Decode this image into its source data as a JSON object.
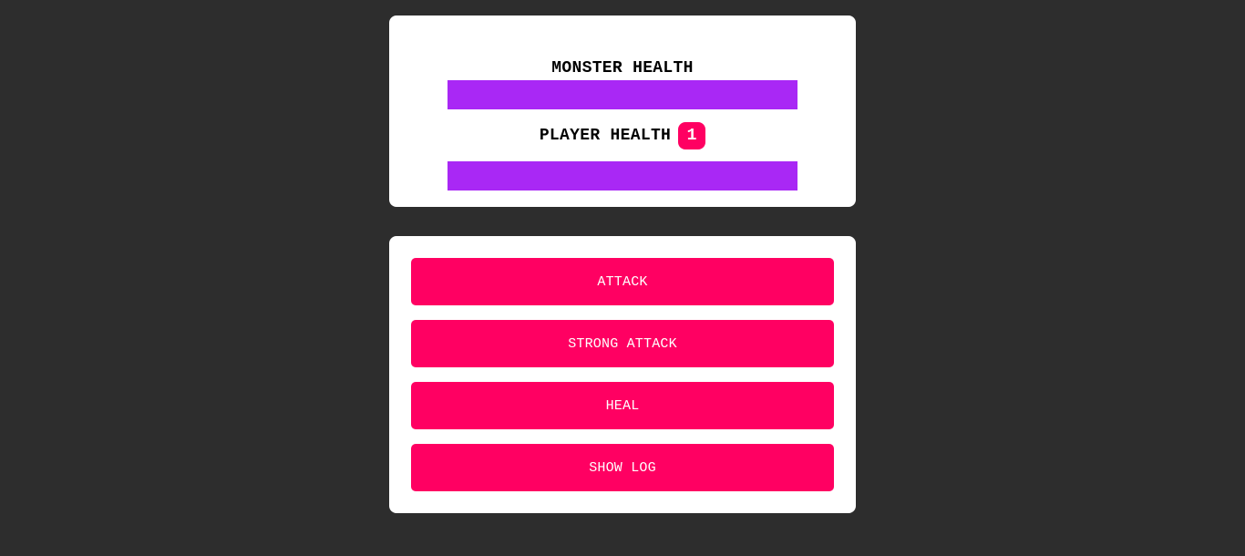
{
  "colors": {
    "background": "#2d2d2d",
    "card": "#ffffff",
    "health_bar": "#a928f5",
    "accent": "#ff0062"
  },
  "health": {
    "monster_title": "MONSTER HEALTH",
    "monster_percent": 100,
    "player_title": "PLAYER HEALTH",
    "player_badge": "1",
    "player_percent": 100
  },
  "controls": {
    "attack_label": "ATTACK",
    "strong_attack_label": "STRONG ATTACK",
    "heal_label": "HEAL",
    "show_log_label": "SHOW LOG"
  }
}
